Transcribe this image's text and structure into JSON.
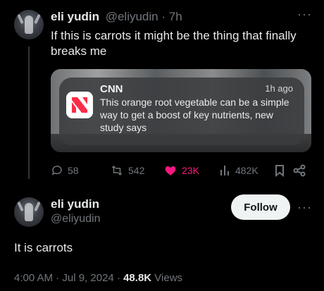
{
  "reply_tweet": {
    "display_name": "eli yudin",
    "handle": "@eliyudin",
    "separator": "·",
    "time": "7h",
    "text": "If this is carrots it might be the thing that finally breaks me",
    "more_label": "···",
    "embedded_notification": {
      "source": "CNN",
      "age": "1h ago",
      "body": "This orange root vegetable can be a simple way to get a boost of key nutrients, new study says",
      "icon": "apple-news-icon"
    },
    "metrics": {
      "replies": "58",
      "reposts": "542",
      "likes": "23K",
      "views": "482K"
    },
    "colors": {
      "like_active": "#f91880",
      "muted": "#71767b"
    }
  },
  "main_tweet": {
    "display_name": "eli yudin",
    "handle": "@eliyudin",
    "follow_label": "Follow",
    "more_label": "···",
    "text": "It is carrots",
    "timestamp": "4:00 AM · Jul 9, 2024 · ",
    "views_count": "48.8K",
    "views_label": " Views"
  }
}
